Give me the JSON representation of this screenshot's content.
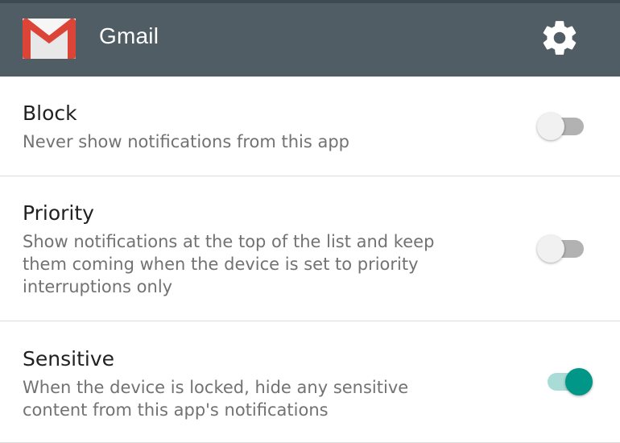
{
  "header": {
    "title": "Gmail",
    "app_icon": "gmail-envelope-icon",
    "settings_icon": "gear-icon",
    "background": "#505d64"
  },
  "settings": [
    {
      "key": "block",
      "title": "Block",
      "description": "Never show notifications from this app",
      "enabled": false
    },
    {
      "key": "priority",
      "title": "Priority",
      "description": "Show notifications at the top of the list and keep them coming when the device is set to priority interruptions only",
      "enabled": false
    },
    {
      "key": "sensitive",
      "title": "Sensitive",
      "description": "When the device is locked, hide any sensitive content from this app's notifications",
      "enabled": true
    }
  ],
  "colors": {
    "accent": "#009688",
    "accent_track": "#a9dcd6",
    "off_track": "#b2b2b2",
    "off_thumb": "#f1f1f1"
  }
}
